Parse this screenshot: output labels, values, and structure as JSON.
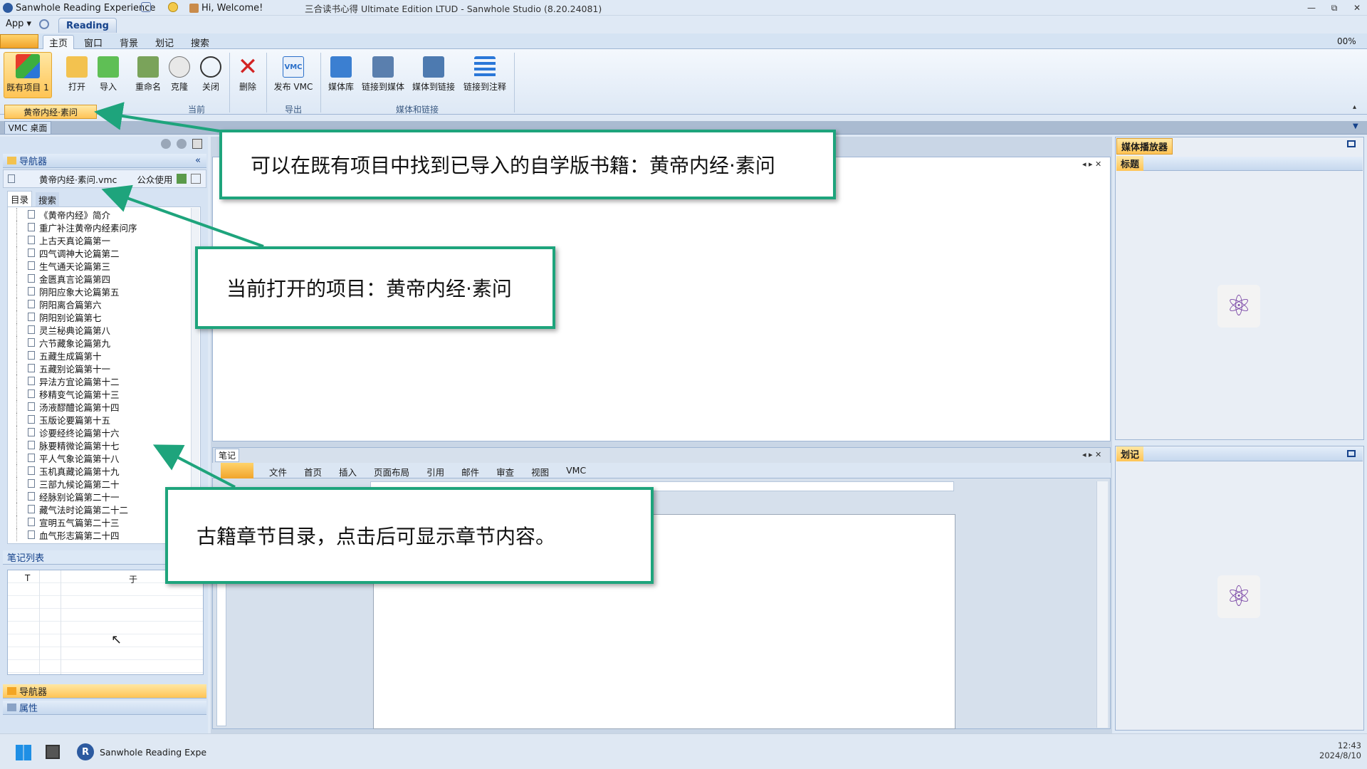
{
  "titlebar": {
    "app_name": "Sanwhole Reading Experience",
    "welcome": "Hi, Welcome!",
    "window_title": "三合读书心得 Ultimate Edition LTUD - Sanwhole Studio (8.20.24081)"
  },
  "appmenu": {
    "app_label": "App",
    "reading_tab": "Reading"
  },
  "ribbon_tabs": [
    "主页",
    "窗口",
    "背景",
    "划记",
    "搜索"
  ],
  "ribbon_tabs_active": "主页",
  "zoom": "00%",
  "ribbon": {
    "existing_projects": "既有项目 1",
    "open": "打开",
    "import": "导入",
    "rename": "重命名",
    "clone": "克隆",
    "close": "关闭",
    "delete": "删除",
    "publish_vmc": "发布 VMC",
    "media_library": "媒体库",
    "link_to_media": "链接到媒体",
    "media_to_link": "媒体到链接",
    "link_to_note": "链接到注释",
    "group_current": "当前",
    "group_export": "导出",
    "group_media_link": "媒体和链接"
  },
  "dropdown_item": "黄帝内经·素问",
  "vmc_desktop_tab": "VMC 桌面",
  "navigator": {
    "header": "导航器",
    "file_name": "黄帝内经·素问.vmc",
    "usage": "公众使用",
    "tab_toc": "目录",
    "tab_search": "搜索",
    "toc_items": [
      "《黄帝内经》简介",
      "重广补注黄帝内经素问序",
      "上古天真论篇第一",
      "四气调神大论篇第二",
      "生气通天论篇第三",
      "金匮真言论篇第四",
      "阴阳应象大论篇第五",
      "阴阳离合篇第六",
      "阴阳别论篇第七",
      "灵兰秘典论篇第八",
      "六节藏象论篇第九",
      "五藏生成篇第十",
      "五藏别论篇第十一",
      "异法方宜论篇第十二",
      "移精变气论篇第十三",
      "汤液醪醴论篇第十四",
      "玉版论要篇第十五",
      "诊要经终论篇第十六",
      "脉要精微论篇第十七",
      "平人气象论篇第十八",
      "玉机真藏论篇第十九",
      "三部九候论篇第二十",
      "经脉别论篇第二十一",
      "藏气法时论篇第二十二",
      "宣明五气篇第二十三",
      "血气形志篇第二十四"
    ],
    "notes_list": "笔记列表",
    "notes_col1": "T",
    "notes_col2": "于",
    "bottom_nav": "导航器",
    "bottom_props": "属性"
  },
  "notes_panel": {
    "tab": "笔记",
    "word_tabs": [
      "文件",
      "首页",
      "插入",
      "页面布局",
      "引用",
      "邮件",
      "审查",
      "视图",
      "VMC"
    ]
  },
  "right": {
    "media_player": "媒体播放器",
    "title_tab": "标题",
    "highlight_tab": "划记"
  },
  "callouts": {
    "c1": "可以在既有项目中找到已导入的自学版书籍：黄帝内经·素问",
    "c2": "当前打开的项目：黄帝内经·素问",
    "c3": "古籍章节目录，点击后可显示章节内容。"
  },
  "taskbar": {
    "app": "Sanwhole Reading Expe",
    "time": "12:43",
    "date": "2024/8/10"
  },
  "colors": {
    "callout_border": "#1ea47c",
    "ribbon_highlight": "#ffc455",
    "header_blue": "#15428b"
  }
}
